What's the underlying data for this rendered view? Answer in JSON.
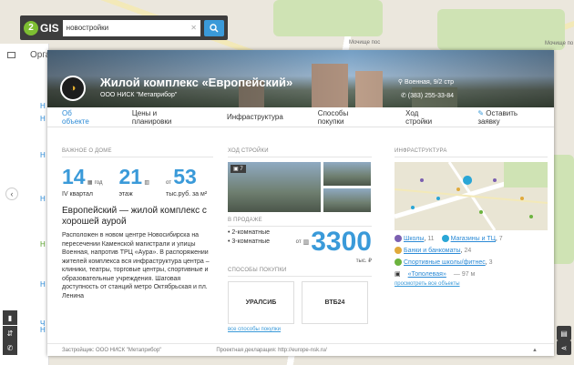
{
  "search": {
    "value": "новостройки"
  },
  "logo": {
    "text": "GIS",
    "digit": "2"
  },
  "leftstrip": {
    "tab": "Орга",
    "items": [
      "Н",
      "Н",
      "Н",
      "Н",
      "Н",
      "Н",
      "Н",
      "Ч"
    ]
  },
  "map_labels": [
    "Мочище пос",
    "Мочище по"
  ],
  "card": {
    "title": "Жилой комплекс «Европейский»",
    "developer": "ООО НИСК \"Метаприбор\"",
    "address": "Военная, 9/2 стр",
    "phone": "(383) 255-33-84",
    "tabs": [
      "Об объекте",
      "Цены и планировки",
      "Инфраструктура",
      "Способы покупки",
      "Ход стройки"
    ],
    "cta": "Оставить заявку",
    "important": {
      "title": "Важное о доме",
      "stats": [
        {
          "value": "14",
          "unit": "год",
          "label": "IV квартал"
        },
        {
          "value": "21",
          "unit": "",
          "label": "этаж"
        },
        {
          "value": "53",
          "unit": "от",
          "label": "тыс.руб. за м²"
        }
      ],
      "headline": "Европейский — жилой комплекс с хорошей аурой",
      "text": "Расположен в новом центре Новосибирска на пересечении Каменской магистрали и улицы Военная, напротив ТРЦ «Аура». В распоряжении жителей комплекса вся инфраструктура центра – клиники, театры, торговые центры, спортивные и образовательные учреждения. Шаговая доступность от станций метро Октябрьская и пл. Ленина"
    },
    "construction": {
      "title": "Ход стройки",
      "photo_count": "7",
      "sale_title": "В продаже",
      "sale_items": [
        "2-комнатные",
        "3-комнатные"
      ],
      "price_from": "от",
      "price": "3300",
      "price_unit": "тыс. ₽",
      "pay_title": "Способы покупки",
      "banks": [
        "УРАЛСИБ",
        "ВТБ24"
      ],
      "pay_link": "все способы покупки"
    },
    "infra": {
      "title": "Инфраструктура",
      "items": [
        {
          "name": "Школы",
          "count": "11",
          "color": "#7b5fb0"
        },
        {
          "name": "Магазины и ТЦ",
          "count": "7",
          "color": "#2aa6d6"
        },
        {
          "name": "Банки и банкоматы",
          "count": "24",
          "color": "#e0a93b"
        },
        {
          "name": "Спортивные школы/фитнес",
          "count": "3",
          "color": "#6cb33e"
        }
      ],
      "metro": "«Тополевая»",
      "metro_dist": "— 97 м",
      "all_link": "просмотреть все объекты"
    },
    "footer": {
      "developer": "Застройщик: ООО НИСК \"Метаприбор\"",
      "declaration": "Проектная декларация: http://europe-nsk.ru/"
    }
  },
  "colors": {
    "accent": "#3a9ad9",
    "link": "#2b8ad6",
    "toolbar": "#3d3d3d",
    "brand_green": "#7dbe32"
  }
}
